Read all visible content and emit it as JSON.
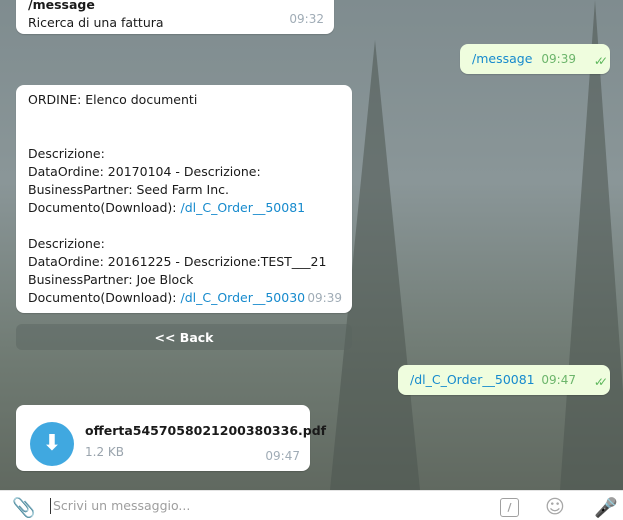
{
  "messages": {
    "m1": {
      "sender": "/message",
      "text": "Ricerca di una fattura",
      "time": "09:32"
    },
    "m2": {
      "text": "/message",
      "time": "09:39"
    },
    "m3": {
      "title": "ORDINE: Elenco documenti",
      "e1_desc": "Descrizione:",
      "e1_date": "DataOrdine: 20170104 - Descrizione:",
      "e1_partner": "BusinessPartner: Seed Farm Inc.",
      "e1_doc_label": "Documento(Download): ",
      "e1_doc_link": "/dl_C_Order__50081",
      "e2_desc": "Descrizione:",
      "e2_date": "DataOrdine: 20161225 - Descrizione:TEST___21",
      "e2_partner": "BusinessPartner: Joe Block",
      "e2_doc_label": "Documento(Download): ",
      "e2_doc_link": "/dl_C_Order__50030",
      "time": "09:39"
    },
    "back_button": "<< Back",
    "m4": {
      "text": "/dl_C_Order__50081",
      "time": "09:47"
    },
    "m5": {
      "filename": "offerta5457058021200380336.pdf",
      "size": "1.2 KB",
      "time": "09:47"
    }
  },
  "input": {
    "placeholder": "Scrivi un messaggio..."
  },
  "icons": {
    "attach": "paperclip-icon",
    "commands": "slash-command-icon",
    "emoji": "smile-icon",
    "mic": "microphone-icon",
    "download": "download-arrow-icon",
    "read": "double-check-icon"
  },
  "colors": {
    "outgoing": "#effdde",
    "link": "#168acd",
    "check": "#5fb85d",
    "file_icon": "#40a8e0"
  }
}
